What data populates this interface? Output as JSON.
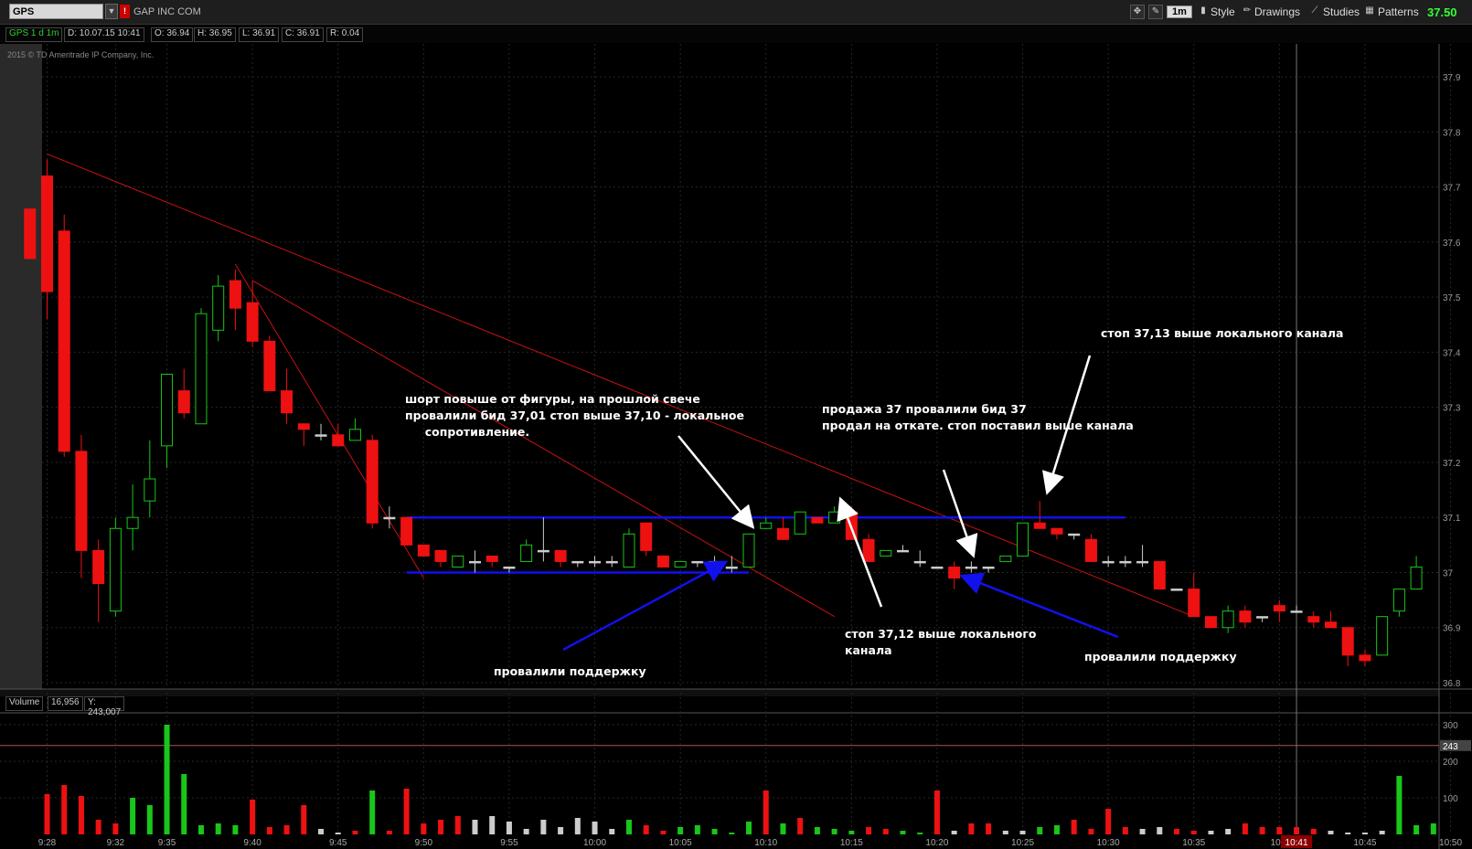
{
  "toolbar": {
    "symbol": "GPS",
    "flag": "!",
    "company": "GAP INC COM",
    "timeframe": "1m",
    "style_label": "Style",
    "drawings_label": "Drawings",
    "studies_label": "Studies",
    "patterns_label": "Patterns",
    "last_price": "37.50"
  },
  "info": {
    "period": "GPS 1 d 1m",
    "date": "D: 10.07.15 10:41",
    "open": "O: 36.94",
    "high": "H: 36.95",
    "low": "L: 36.91",
    "close": "C: 36.91",
    "range": "R: 0.04"
  },
  "copyright": "2015 © TD Ameritrade IP Company, Inc.",
  "volume_info": {
    "label": "Volume",
    "value": "16,956",
    "y": "Y: 243,007"
  },
  "annotations": {
    "note1": "шорт повыше от фигуры, на прошлой свече\nпровалили бид 37,01 стоп выше 37,10 - локальное\n     сопротивление.",
    "note2": "провалили поддержку",
    "note3": "продажа 37 провалили бид 37\nпродал на откате. стоп поставил выше канала",
    "note4": "стоп 37,12 выше локального\nканала",
    "note5": "стоп 37,13 выше локального канала",
    "note6": "провалили поддержку"
  },
  "colors": {
    "up": "#19c619",
    "down": "#ee1111",
    "neutral": "#cccccc",
    "support_line": "#1010ee",
    "trend_line": "#cc1111",
    "grid": "#262626"
  },
  "chart_data": [
    {
      "type": "candlestick",
      "title": "GPS 1 d 1m",
      "ylim": [
        36.8,
        37.94
      ],
      "y_ticks": [
        "37.9",
        "37.8",
        "37.7",
        "37.6",
        "37.5",
        "37.4",
        "37.3",
        "37.2",
        "37.1",
        "37",
        "36.9",
        "36.8"
      ],
      "x_ticks": [
        "9:28",
        "9:32",
        "9:35",
        "9:40",
        "9:45",
        "9:50",
        "9:55",
        "10:00",
        "10:05",
        "10:10",
        "10:15",
        "10:20",
        "10:25",
        "10:30",
        "10:35",
        "10:4",
        "10:41",
        "10:45",
        "10:50"
      ],
      "cursor_label": "10:41",
      "ohlc": [
        {
          "t": "9:27",
          "o": 37.66,
          "h": 37.66,
          "l": 37.57,
          "c": 37.57
        },
        {
          "t": "9:28",
          "o": 37.72,
          "h": 37.75,
          "l": 37.46,
          "c": 37.51
        },
        {
          "t": "9:29",
          "o": 37.62,
          "h": 37.65,
          "l": 37.21,
          "c": 37.22
        },
        {
          "t": "9:30",
          "o": 37.22,
          "h": 37.25,
          "l": 36.99,
          "c": 37.04
        },
        {
          "t": "9:31",
          "o": 37.04,
          "h": 37.06,
          "l": 36.91,
          "c": 36.98
        },
        {
          "t": "9:32",
          "o": 36.93,
          "h": 37.1,
          "l": 36.92,
          "c": 37.08
        },
        {
          "t": "9:33",
          "o": 37.08,
          "h": 37.16,
          "l": 37.04,
          "c": 37.1
        },
        {
          "t": "9:34",
          "o": 37.13,
          "h": 37.24,
          "l": 37.1,
          "c": 37.17
        },
        {
          "t": "9:35",
          "o": 37.23,
          "h": 37.36,
          "l": 37.19,
          "c": 37.36
        },
        {
          "t": "9:36",
          "o": 37.33,
          "h": 37.37,
          "l": 37.28,
          "c": 37.29
        },
        {
          "t": "9:37",
          "o": 37.27,
          "h": 37.48,
          "l": 37.27,
          "c": 37.47
        },
        {
          "t": "9:38",
          "o": 37.44,
          "h": 37.54,
          "l": 37.42,
          "c": 37.52
        },
        {
          "t": "9:39",
          "o": 37.53,
          "h": 37.55,
          "l": 37.44,
          "c": 37.48
        },
        {
          "t": "9:40",
          "o": 37.49,
          "h": 37.53,
          "l": 37.41,
          "c": 37.42
        },
        {
          "t": "9:41",
          "o": 37.42,
          "h": 37.43,
          "l": 37.33,
          "c": 37.33
        },
        {
          "t": "9:42",
          "o": 37.33,
          "h": 37.37,
          "l": 37.27,
          "c": 37.29
        },
        {
          "t": "9:43",
          "o": 37.27,
          "h": 37.27,
          "l": 37.23,
          "c": 37.26
        },
        {
          "t": "9:44",
          "o": 37.25,
          "h": 37.27,
          "l": 37.24,
          "c": 37.25
        },
        {
          "t": "9:45",
          "o": 37.25,
          "h": 37.27,
          "l": 37.23,
          "c": 37.23
        },
        {
          "t": "9:46",
          "o": 37.24,
          "h": 37.28,
          "l": 37.24,
          "c": 37.26
        },
        {
          "t": "9:47",
          "o": 37.24,
          "h": 37.25,
          "l": 37.08,
          "c": 37.09
        },
        {
          "t": "9:48",
          "o": 37.1,
          "h": 37.12,
          "l": 37.08,
          "c": 37.1
        },
        {
          "t": "9:49",
          "o": 37.1,
          "h": 37.1,
          "l": 37.05,
          "c": 37.05
        },
        {
          "t": "9:50",
          "o": 37.05,
          "h": 37.05,
          "l": 37.03,
          "c": 37.03
        },
        {
          "t": "9:51",
          "o": 37.04,
          "h": 37.04,
          "l": 37.01,
          "c": 37.02
        },
        {
          "t": "9:52",
          "o": 37.01,
          "h": 37.03,
          "l": 37.01,
          "c": 37.03
        },
        {
          "t": "9:53",
          "o": 37.02,
          "h": 37.04,
          "l": 37.0,
          "c": 37.02
        },
        {
          "t": "9:54",
          "o": 37.03,
          "h": 37.03,
          "l": 37.01,
          "c": 37.02
        },
        {
          "t": "9:55",
          "o": 37.01,
          "h": 37.01,
          "l": 37.0,
          "c": 37.01
        },
        {
          "t": "9:56",
          "o": 37.02,
          "h": 37.06,
          "l": 37.02,
          "c": 37.05
        },
        {
          "t": "9:57",
          "o": 37.04,
          "h": 37.1,
          "l": 37.02,
          "c": 37.04
        },
        {
          "t": "9:58",
          "o": 37.04,
          "h": 37.04,
          "l": 37.01,
          "c": 37.02
        },
        {
          "t": "9:59",
          "o": 37.02,
          "h": 37.02,
          "l": 37.01,
          "c": 37.02
        },
        {
          "t": "10:00",
          "o": 37.02,
          "h": 37.03,
          "l": 37.01,
          "c": 37.02
        },
        {
          "t": "10:01",
          "o": 37.02,
          "h": 37.03,
          "l": 37.01,
          "c": 37.02
        },
        {
          "t": "10:02",
          "o": 37.01,
          "h": 37.08,
          "l": 37.01,
          "c": 37.07
        },
        {
          "t": "10:03",
          "o": 37.09,
          "h": 37.09,
          "l": 37.03,
          "c": 37.04
        },
        {
          "t": "10:04",
          "o": 37.03,
          "h": 37.03,
          "l": 37.01,
          "c": 37.01
        },
        {
          "t": "10:05",
          "o": 37.01,
          "h": 37.02,
          "l": 37.01,
          "c": 37.02
        },
        {
          "t": "10:06",
          "o": 37.02,
          "h": 37.02,
          "l": 37.01,
          "c": 37.02
        },
        {
          "t": "10:07",
          "o": 37.02,
          "h": 37.03,
          "l": 37.01,
          "c": 37.02
        },
        {
          "t": "10:08",
          "o": 37.01,
          "h": 37.03,
          "l": 37.0,
          "c": 37.01
        },
        {
          "t": "10:09",
          "o": 37.01,
          "h": 37.07,
          "l": 37.01,
          "c": 37.07
        },
        {
          "t": "10:10",
          "o": 37.08,
          "h": 37.1,
          "l": 37.08,
          "c": 37.09
        },
        {
          "t": "10:11",
          "o": 37.08,
          "h": 37.1,
          "l": 37.06,
          "c": 37.06
        },
        {
          "t": "10:12",
          "o": 37.07,
          "h": 37.11,
          "l": 37.07,
          "c": 37.11
        },
        {
          "t": "10:13",
          "o": 37.1,
          "h": 37.1,
          "l": 37.09,
          "c": 37.09
        },
        {
          "t": "10:14",
          "o": 37.09,
          "h": 37.12,
          "l": 37.09,
          "c": 37.11
        },
        {
          "t": "10:15",
          "o": 37.11,
          "h": 37.12,
          "l": 37.06,
          "c": 37.06
        },
        {
          "t": "10:16",
          "o": 37.06,
          "h": 37.07,
          "l": 37.02,
          "c": 37.02
        },
        {
          "t": "10:17",
          "o": 37.03,
          "h": 37.04,
          "l": 37.03,
          "c": 37.04
        },
        {
          "t": "10:18",
          "o": 37.04,
          "h": 37.05,
          "l": 37.04,
          "c": 37.04
        },
        {
          "t": "10:19",
          "o": 37.02,
          "h": 37.04,
          "l": 37.01,
          "c": 37.02
        },
        {
          "t": "10:20",
          "o": 37.01,
          "h": 37.01,
          "l": 37.01,
          "c": 37.01
        },
        {
          "t": "10:21",
          "o": 37.01,
          "h": 37.02,
          "l": 36.97,
          "c": 36.99
        },
        {
          "t": "10:22",
          "o": 37.01,
          "h": 37.02,
          "l": 37.0,
          "c": 37.01
        },
        {
          "t": "10:23",
          "o": 37.01,
          "h": 37.01,
          "l": 37.0,
          "c": 37.01
        },
        {
          "t": "10:24",
          "o": 37.02,
          "h": 37.03,
          "l": 37.02,
          "c": 37.03
        },
        {
          "t": "10:25",
          "o": 37.03,
          "h": 37.09,
          "l": 37.03,
          "c": 37.09
        },
        {
          "t": "10:26",
          "o": 37.09,
          "h": 37.13,
          "l": 37.08,
          "c": 37.08
        },
        {
          "t": "10:27",
          "o": 37.08,
          "h": 37.08,
          "l": 37.06,
          "c": 37.07
        },
        {
          "t": "10:28",
          "o": 37.07,
          "h": 37.07,
          "l": 37.06,
          "c": 37.07
        },
        {
          "t": "10:29",
          "o": 37.06,
          "h": 37.07,
          "l": 37.02,
          "c": 37.02
        },
        {
          "t": "10:30",
          "o": 37.02,
          "h": 37.03,
          "l": 37.01,
          "c": 37.02
        },
        {
          "t": "10:31",
          "o": 37.02,
          "h": 37.03,
          "l": 37.01,
          "c": 37.02
        },
        {
          "t": "10:32",
          "o": 37.02,
          "h": 37.05,
          "l": 37.01,
          "c": 37.02
        },
        {
          "t": "10:33",
          "o": 37.02,
          "h": 37.02,
          "l": 36.97,
          "c": 36.97
        },
        {
          "t": "10:34",
          "o": 36.97,
          "h": 36.97,
          "l": 36.97,
          "c": 36.97
        },
        {
          "t": "10:35",
          "o": 36.97,
          "h": 37.0,
          "l": 36.92,
          "c": 36.92
        },
        {
          "t": "10:36",
          "o": 36.92,
          "h": 36.92,
          "l": 36.9,
          "c": 36.9
        },
        {
          "t": "10:37",
          "o": 36.9,
          "h": 36.94,
          "l": 36.89,
          "c": 36.93
        },
        {
          "t": "10:38",
          "o": 36.93,
          "h": 36.94,
          "l": 36.9,
          "c": 36.91
        },
        {
          "t": "10:39",
          "o": 36.92,
          "h": 36.92,
          "l": 36.91,
          "c": 36.92
        },
        {
          "t": "10:40",
          "o": 36.94,
          "h": 36.95,
          "l": 36.91,
          "c": 36.93
        },
        {
          "t": "10:41",
          "o": 36.93,
          "h": 36.94,
          "l": 36.93,
          "c": 36.93
        },
        {
          "t": "10:42",
          "o": 36.92,
          "h": 36.93,
          "l": 36.9,
          "c": 36.91
        },
        {
          "t": "10:43",
          "o": 36.91,
          "h": 36.93,
          "l": 36.9,
          "c": 36.9
        },
        {
          "t": "10:44",
          "o": 36.9,
          "h": 36.9,
          "l": 36.83,
          "c": 36.85
        },
        {
          "t": "10:45",
          "o": 36.85,
          "h": 36.86,
          "l": 36.83,
          "c": 36.84
        },
        {
          "t": "10:46",
          "o": 36.85,
          "h": 36.92,
          "l": 36.85,
          "c": 36.92
        },
        {
          "t": "10:47",
          "o": 36.93,
          "h": 36.97,
          "l": 36.92,
          "c": 36.97
        },
        {
          "t": "10:48",
          "o": 36.97,
          "h": 37.03,
          "l": 36.97,
          "c": 37.01
        }
      ],
      "support_level": 37.0,
      "resistance_level": 37.1,
      "trendlines": [
        {
          "from": {
            "t": "9:28",
            "p": 37.76
          },
          "to": {
            "t": "10:35",
            "p": 36.92
          }
        },
        {
          "from": {
            "t": "9:39",
            "p": 37.56
          },
          "to": {
            "t": "9:50",
            "p": 36.99
          }
        },
        {
          "from": {
            "t": "9:40",
            "p": 37.53
          },
          "to": {
            "t": "10:14",
            "p": 36.92
          }
        }
      ]
    },
    {
      "type": "bar",
      "title": "Volume",
      "ylim": [
        0,
        330000
      ],
      "y_ticks": [
        "300",
        "200",
        "100"
      ],
      "y_marker": "243",
      "y_marker_value": 243007,
      "values": [
        0,
        110000,
        135000,
        105000,
        40000,
        30000,
        100000,
        80000,
        300000,
        165000,
        25000,
        30000,
        25000,
        95000,
        20000,
        25000,
        80000,
        15000,
        5000,
        10000,
        120000,
        10000,
        125000,
        30000,
        40000,
        50000,
        40000,
        50000,
        35000,
        15000,
        40000,
        20000,
        45000,
        35000,
        15000,
        40000,
        25000,
        10000,
        20000,
        25000,
        15000,
        5000,
        35000,
        120000,
        30000,
        45000,
        20000,
        15000,
        10000,
        20000,
        15000,
        10000,
        5000,
        120000,
        10000,
        30000,
        30000,
        10000,
        10000,
        20000,
        25000,
        40000,
        15000,
        70000,
        20000,
        15000,
        20000,
        15000,
        10000,
        10000,
        15000,
        30000,
        20000,
        20000,
        20000,
        15000,
        10000,
        5000,
        5000,
        10000,
        160000,
        25000,
        30000,
        0,
        0
      ],
      "up_flags": [
        0,
        0,
        0,
        0,
        0,
        0,
        1,
        1,
        1,
        1,
        1,
        1,
        1,
        0,
        0,
        0,
        0,
        2,
        2,
        0,
        1,
        0,
        0,
        0,
        0,
        0,
        2,
        2,
        2,
        2,
        2,
        2,
        2,
        2,
        2,
        1,
        0,
        0,
        1,
        1,
        1,
        1,
        1,
        0,
        1,
        0,
        1,
        1,
        1,
        0,
        0,
        1,
        1,
        0,
        2,
        0,
        0,
        2,
        2,
        1,
        1,
        0,
        0,
        0,
        0,
        2,
        2,
        0,
        0,
        2,
        2,
        0,
        0,
        0,
        0,
        0,
        2,
        2,
        2,
        2,
        1,
        1,
        1,
        0,
        0
      ]
    }
  ]
}
